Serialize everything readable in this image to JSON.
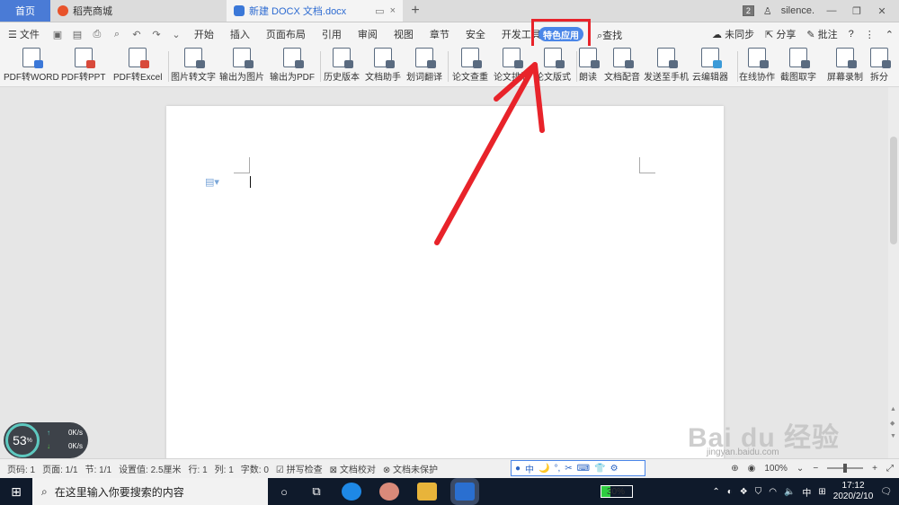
{
  "tabs": {
    "home": "首页",
    "items": [
      {
        "label": "稻壳商城",
        "active": false
      },
      {
        "label": "新建 DOCX 文档.docx",
        "active": true
      }
    ],
    "new_tab": "+",
    "badge": "2",
    "user": "silence."
  },
  "menu": {
    "file": "文件",
    "items": [
      "开始",
      "插入",
      "页面布局",
      "引用",
      "审阅",
      "视图",
      "章节",
      "安全",
      "开发工具"
    ],
    "special": "特色应用",
    "search": "查找",
    "right": [
      "未同步",
      "分享",
      "批注"
    ]
  },
  "toolbar": {
    "tools": [
      {
        "label": "PDF转WORD",
        "color": "#3b78d8"
      },
      {
        "label": "PDF转PPT",
        "color": "#d84a3b"
      },
      {
        "label": "PDF转Excel",
        "color": "#d84a3b"
      },
      {
        "label": "图片转文字",
        "color": "#5a6b80"
      },
      {
        "label": "输出为图片",
        "color": "#5a6b80"
      },
      {
        "label": "输出为PDF",
        "color": "#5a6b80"
      },
      {
        "label": "历史版本",
        "color": "#5a6b80"
      },
      {
        "label": "文档助手",
        "color": "#5a6b80"
      },
      {
        "label": "划词翻译",
        "color": "#5a6b80"
      },
      {
        "label": "论文查重",
        "color": "#5a6b80"
      },
      {
        "label": "论文排版",
        "color": "#5a6b80"
      },
      {
        "label": "论文版式",
        "color": "#5a6b80"
      },
      {
        "label": "朗读",
        "color": "#5a6b80"
      },
      {
        "label": "文档配音",
        "color": "#5a6b80"
      },
      {
        "label": "发送至手机",
        "color": "#5a6b80"
      },
      {
        "label": "云编辑器",
        "color": "#3b9ad8"
      },
      {
        "label": "在线协作",
        "color": "#5a6b80"
      },
      {
        "label": "截图取字",
        "color": "#5a6b80"
      },
      {
        "label": "屏幕录制",
        "color": "#5a6b80"
      },
      {
        "label": "拆分",
        "color": "#5a6b80"
      }
    ]
  },
  "widget": {
    "percent": "53",
    "percent_unit": "%",
    "up": "0K/s",
    "down": "0K/s"
  },
  "watermark": {
    "text": "Bai du 经验",
    "sub": "jingyan.baidu.com"
  },
  "status": {
    "page_no": "页码: 1",
    "pages": "页面: 1/1",
    "section": "节: 1/1",
    "setting": "设置值: 2.5厘米",
    "row": "行: 1",
    "col": "列: 1",
    "words": "字数: 0",
    "spell": "拼写检查",
    "proof": "文档校对",
    "protect": "文档未保护",
    "zoom": "100%",
    "ime": [
      "中",
      "🌙",
      "°,",
      "✂",
      "⌨",
      "👕",
      "⚙"
    ]
  },
  "taskbar": {
    "search_placeholder": "在这里输入你要搜索的内容",
    "battery": "30%",
    "ime": "中",
    "time": "17:12",
    "date": "2020/2/10"
  }
}
